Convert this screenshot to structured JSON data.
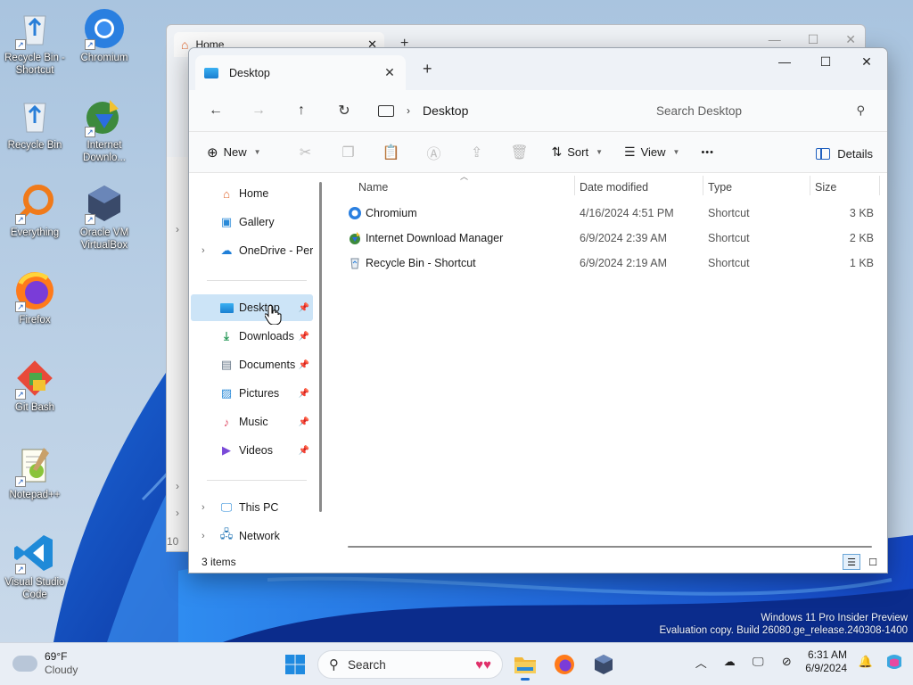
{
  "desktop": {
    "icons": [
      {
        "label": "Recycle Bin - Shortcut"
      },
      {
        "label": "Chromium"
      },
      {
        "label": "Recycle Bin"
      },
      {
        "label": "Internet Downlo..."
      },
      {
        "label": "Everything"
      },
      {
        "label": "Oracle VM VirtualBox"
      },
      {
        "label": "Firefox"
      },
      {
        "label": "Git Bash"
      },
      {
        "label": "Notepad++"
      },
      {
        "label": "Visual Studio Code"
      }
    ],
    "watermark_line1": "Windows 11 Pro Insider Preview",
    "watermark_line2": "Evaluation copy. Build 26080.ge_release.240308-1400"
  },
  "background_window": {
    "tab_title": "Home",
    "partial_text": "10"
  },
  "window": {
    "tab_title": "Desktop",
    "new_tab": "+",
    "controls": {
      "minimize": "—",
      "maximize": "☐",
      "close": "✕"
    },
    "nav": {
      "back": "←",
      "forward": "→",
      "up": "↑",
      "refresh": "↻"
    },
    "address": {
      "crumb": "Desktop"
    },
    "search": {
      "placeholder": "Search Desktop"
    },
    "commands": {
      "new": "New",
      "sort": "Sort",
      "view": "View",
      "more": "•••",
      "details": "Details"
    },
    "sidebar": {
      "home": "Home",
      "gallery": "Gallery",
      "onedrive": "OneDrive - Pers",
      "desktop": "Desktop",
      "downloads": "Downloads",
      "documents": "Documents",
      "pictures": "Pictures",
      "music": "Music",
      "videos": "Videos",
      "this_pc": "This PC",
      "network": "Network"
    },
    "columns": {
      "name": "Name",
      "date": "Date modified",
      "type": "Type",
      "size": "Size"
    },
    "files": [
      {
        "name": "Chromium",
        "date": "4/16/2024 4:51 PM",
        "type": "Shortcut",
        "size": "3 KB"
      },
      {
        "name": "Internet Download Manager",
        "date": "6/9/2024 2:39 AM",
        "type": "Shortcut",
        "size": "2 KB"
      },
      {
        "name": "Recycle Bin - Shortcut",
        "date": "6/9/2024 2:19 AM",
        "type": "Shortcut",
        "size": "1 KB"
      }
    ],
    "status": "3 items"
  },
  "taskbar": {
    "weather_temp": "69°F",
    "weather_desc": "Cloudy",
    "search_label": "Search",
    "time": "6:31 AM",
    "date": "6/9/2024"
  }
}
